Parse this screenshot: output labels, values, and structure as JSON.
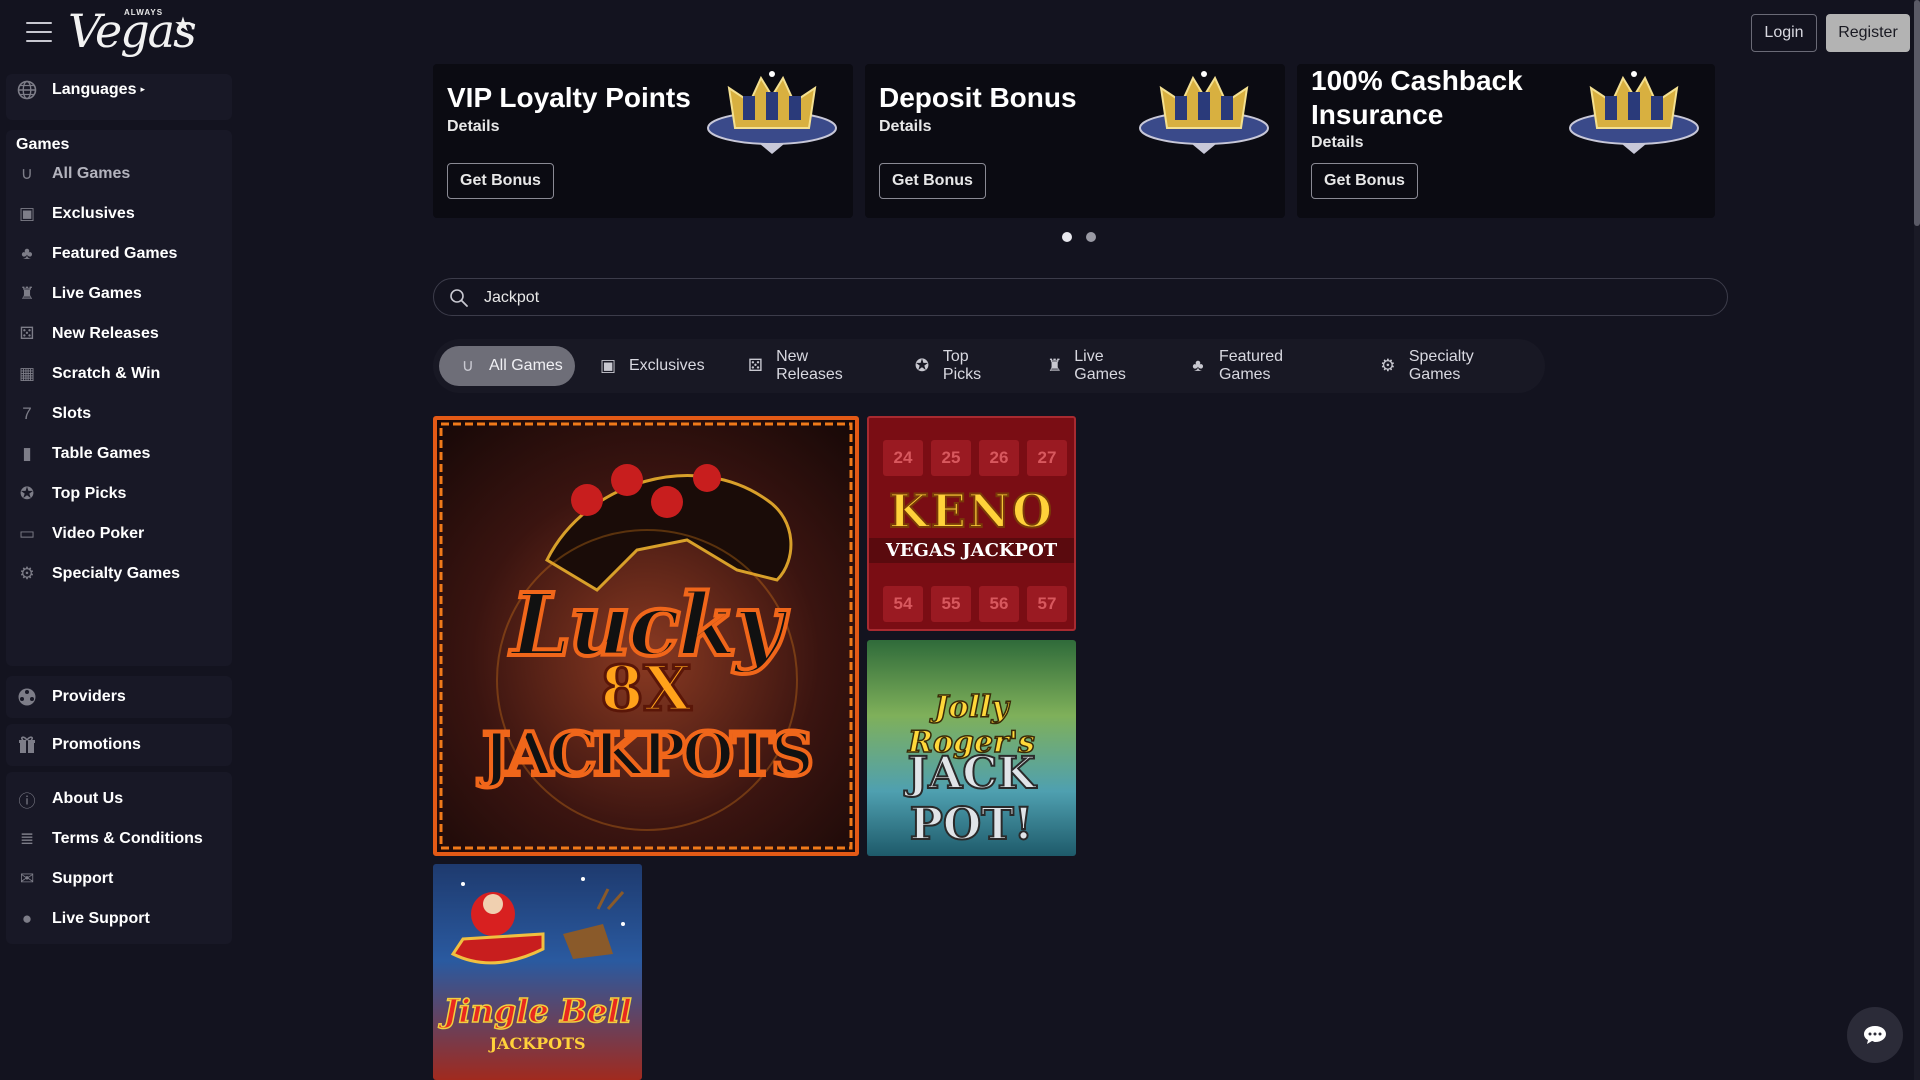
{
  "header": {
    "logo_small": "ALWAYS",
    "logo_text": "Vegas",
    "login_label": "Login",
    "register_label": "Register"
  },
  "sidebar": {
    "languages_label": "Languages",
    "games_heading": "Games",
    "game_items": [
      {
        "label": "All Games",
        "icon": "horseshoe-icon",
        "active": true
      },
      {
        "label": "Exclusives",
        "icon": "exclusive-icon"
      },
      {
        "label": "Featured Games",
        "icon": "clover-icon"
      },
      {
        "label": "Live Games",
        "icon": "dealer-icon"
      },
      {
        "label": "New Releases",
        "icon": "dice-icon"
      },
      {
        "label": "Scratch & Win",
        "icon": "scratch-icon"
      },
      {
        "label": "Slots",
        "icon": "seven-icon"
      },
      {
        "label": "Table Games",
        "icon": "card-icon"
      },
      {
        "label": "Top Picks",
        "icon": "ribbon-icon"
      },
      {
        "label": "Video Poker",
        "icon": "monitor-icon"
      },
      {
        "label": "Specialty Games",
        "icon": "gear-icon"
      }
    ],
    "providers_label": "Providers",
    "promotions_label": "Promotions",
    "info_items": [
      {
        "label": "About Us",
        "icon": "info-icon"
      },
      {
        "label": "Terms & Conditions",
        "icon": "document-icon"
      },
      {
        "label": "Support",
        "icon": "envelope-icon"
      },
      {
        "label": "Live Support",
        "icon": "chat-bubble-icon"
      }
    ]
  },
  "promos": [
    {
      "title": "VIP Loyalty Points",
      "details": "Details",
      "button": "Get Bonus"
    },
    {
      "title": "Deposit Bonus",
      "details": "Details",
      "button": "Get Bonus"
    },
    {
      "title": "100% Cashback Insurance",
      "details": "Details",
      "button": "Get Bonus"
    }
  ],
  "carousel": {
    "pages": 2,
    "current": 1
  },
  "search": {
    "value": "Jackpot",
    "placeholder": "Search"
  },
  "tabs": [
    {
      "label": "All Games",
      "icon": "horseshoe-icon",
      "active": true
    },
    {
      "label": "Exclusives",
      "icon": "exclusive-icon"
    },
    {
      "label": "New Releases",
      "icon": "dice-icon"
    },
    {
      "label": "Top Picks",
      "icon": "ribbon-icon"
    },
    {
      "label": "Live Games",
      "icon": "dealer-icon"
    },
    {
      "label": "Featured Games",
      "icon": "clover-icon"
    },
    {
      "label": "Specialty Games",
      "icon": "gear-icon"
    }
  ],
  "games": [
    {
      "name": "Lucky 8X Jackpots",
      "line1": "Lucky",
      "line2": "8X",
      "line3": "JACKPOTS"
    },
    {
      "name": "Keno Vegas Jackpot",
      "line1": "KENO",
      "line2": "VEGAS JACKPOT",
      "numbers": [
        "24",
        "25",
        "26",
        "27",
        "54",
        "55",
        "56",
        "57"
      ]
    },
    {
      "name": "Jolly Roger's Jackpot",
      "line1": "Jolly Roger's",
      "line2": "JACK POT!"
    },
    {
      "name": "Jingle Bell Jackpots",
      "line1": "Jingle Bell",
      "line2": "JACKPOTS"
    }
  ],
  "colors": {
    "background": "#13131f",
    "card": "#181826",
    "active_tab": "#6e6e78",
    "register_bg": "#b3b3b3"
  }
}
